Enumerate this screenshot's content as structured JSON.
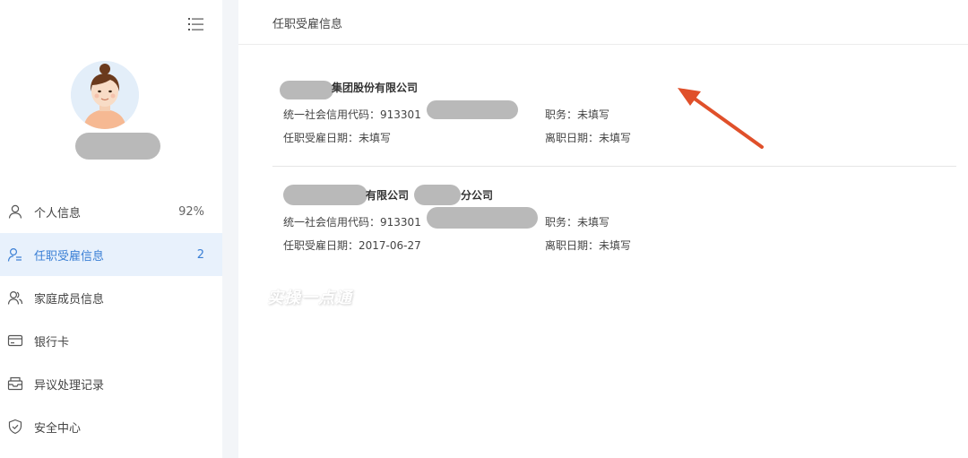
{
  "sidebar": {
    "menu_icon": "list-menu-icon",
    "avatar_icon": "female-avatar-icon",
    "items": [
      {
        "label": "个人信息",
        "count": "92%",
        "icon": "user-icon"
      },
      {
        "label": "任职受雇信息",
        "count": "2",
        "icon": "user-list-icon"
      },
      {
        "label": "家庭成员信息",
        "count": "",
        "icon": "family-icon"
      },
      {
        "label": "银行卡",
        "count": "",
        "icon": "bank-card-icon"
      },
      {
        "label": "异议处理记录",
        "count": "",
        "icon": "inbox-icon"
      },
      {
        "label": "安全中心",
        "count": "",
        "icon": "shield-icon"
      }
    ]
  },
  "main": {
    "title": "任职受雇信息",
    "companies": [
      {
        "name": "集团股份有限公司",
        "credit_label": "统一社会信用代码：",
        "credit_value": "913301",
        "position_label": "职务：",
        "position_value": "未填写",
        "hire_label": "任职受雇日期：",
        "hire_value": "未填写",
        "leave_label": "离职日期：",
        "leave_value": "未填写"
      },
      {
        "name_part1": "有限公司",
        "name_part2": "分公司",
        "credit_label": "统一社会信用代码：",
        "credit_value": "913301",
        "position_label": "职务：",
        "position_value": "未填写",
        "hire_label": "任职受雇日期：",
        "hire_value": "2017-06-27",
        "leave_label": "离职日期：",
        "leave_value": "未填写"
      }
    ],
    "watermark": "实操一点通"
  },
  "colors": {
    "accent": "#3a7fd5",
    "active_bg": "#e8f1fc",
    "arrow": "#e0502a",
    "redact": "#b9b9b9"
  }
}
